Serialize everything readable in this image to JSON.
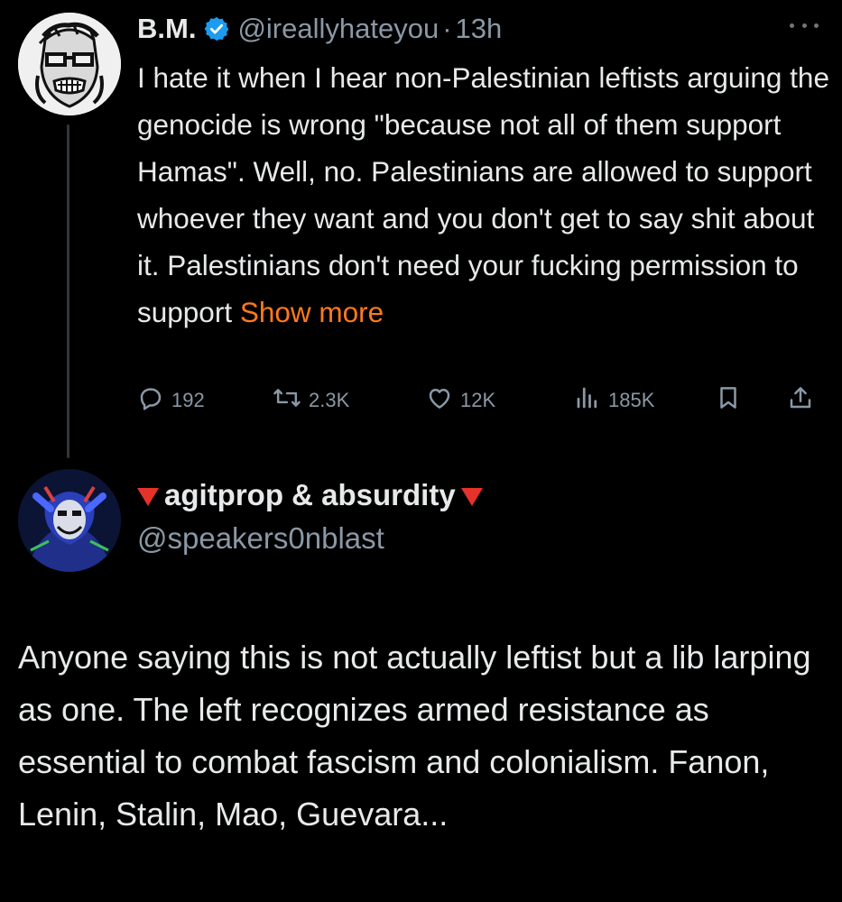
{
  "tweet": {
    "display_name": "B.M.",
    "handle": "@ireallyhateyou",
    "separator": "·",
    "time": "13h",
    "text": "I hate it when I hear non-Palestinian leftists arguing the genocide is wrong \"because not all of them support Hamas\". Well, no. Palestinians are allowed to support whoever they want and you don't get to say shit about it. Palestinians don't need your fucking permission to support ",
    "show_more": "Show more",
    "replies": "192",
    "reposts": "2.3K",
    "likes": "12K",
    "views": "185K"
  },
  "reply": {
    "display_name": "agitprop & absurdity",
    "handle": "@speakers0nblast",
    "text": "Anyone saying this is not actually leftist but a lib larping as one. The left recognizes armed resistance as essential to combat fascism and colonialism. Fanon, Lenin, Stalin, Mao, Guevara..."
  },
  "colors": {
    "background": "#000000",
    "text": "#e7e9ea",
    "muted": "#8b98a5",
    "link": "#ff7a1a",
    "verified": "#1d9bf0",
    "triangle": "#e5322b"
  },
  "icons": [
    "verified-badge-icon",
    "more-icon",
    "reply-icon",
    "repost-icon",
    "like-icon",
    "views-icon",
    "bookmark-icon",
    "share-icon",
    "red-triangle-icon"
  ]
}
